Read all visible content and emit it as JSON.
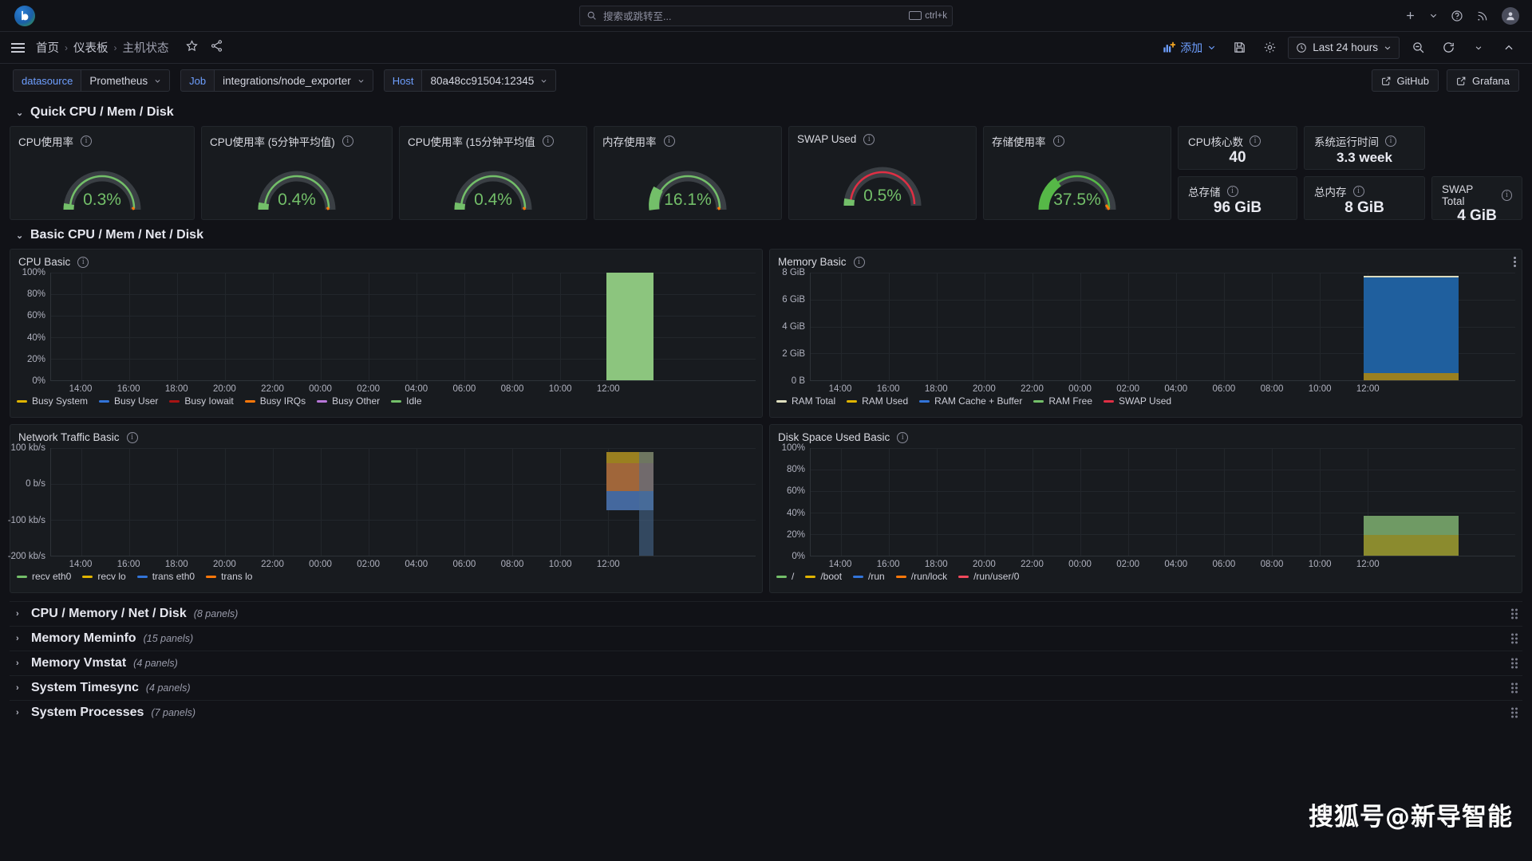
{
  "topbar": {
    "logo_letter": "b",
    "search_placeholder": "搜索或跳转至...",
    "shortcut": "ctrl+k",
    "icons": [
      "plus-icon",
      "chevron-down-icon",
      "help-icon",
      "news-icon",
      "avatar"
    ]
  },
  "navbar": {
    "breadcrumbs": [
      {
        "label": "首页"
      },
      {
        "label": "仪表板"
      },
      {
        "label": "主机状态"
      }
    ],
    "separator": "›",
    "star_icon": "star-icon",
    "share_icon": "share-icon",
    "add_label": "添加",
    "time_range": "Last 24 hours",
    "icons": [
      "save-icon",
      "settings-gear-icon",
      "zoom-out-icon",
      "refresh-icon",
      "collapse-icon"
    ]
  },
  "variables": [
    {
      "name": "datasource",
      "value": "Prometheus"
    },
    {
      "name": "Job",
      "value": "integrations/node_exporter"
    },
    {
      "name": "Host",
      "value": "80a48cc91504:12345"
    }
  ],
  "links": [
    {
      "label": "GitHub"
    },
    {
      "label": "Grafana"
    }
  ],
  "rows": {
    "quick": "Quick CPU / Mem / Disk",
    "basic": "Basic CPU / Mem / Net / Disk"
  },
  "gauges": [
    {
      "title": "CPU使用率",
      "value": "0.3%",
      "pct": 0.3,
      "color": "#73bf69"
    },
    {
      "title": "CPU使用率 (5分钟平均值)",
      "value": "0.4%",
      "pct": 0.4,
      "color": "#73bf69"
    },
    {
      "title": "CPU使用率 (15分钟平均值",
      "value": "0.4%",
      "pct": 0.4,
      "color": "#73bf69"
    },
    {
      "title": "内存使用率",
      "value": "16.1%",
      "pct": 16.1,
      "color": "#73bf69"
    },
    {
      "title": "SWAP Used",
      "value": "0.5%",
      "pct": 0.5,
      "color": "#73bf69"
    },
    {
      "title": "存储使用率",
      "value": "37.5%",
      "pct": 37.5,
      "color": "#56b847"
    }
  ],
  "stats": [
    {
      "title": "CPU核心数",
      "value": "40"
    },
    {
      "title": "系统运行时间",
      "value": "3.3 week"
    },
    {
      "title": "总存储",
      "value": "96 GiB"
    },
    {
      "title": "总内存",
      "value": "8 GiB"
    },
    {
      "title": "SWAP Total",
      "value": "4 GiB"
    }
  ],
  "panels": {
    "cpu_basic": {
      "title": "CPU Basic"
    },
    "memory_basic": {
      "title": "Memory Basic"
    },
    "network_basic": {
      "title": "Network Traffic Basic"
    },
    "disk_basic": {
      "title": "Disk Space Used Basic"
    }
  },
  "collapsed_rows": [
    {
      "title": "CPU / Memory / Net / Disk",
      "panels": "(8 panels)"
    },
    {
      "title": "Memory Meminfo",
      "panels": "(15 panels)"
    },
    {
      "title": "Memory Vmstat",
      "panels": "(4 panels)"
    },
    {
      "title": "System Timesync",
      "panels": "(4 panels)"
    },
    {
      "title": "System Processes",
      "panels": "(7 panels)"
    }
  ],
  "watermark": "搜狐号@新导智能",
  "chart_data": [
    {
      "type": "area",
      "title": "CPU Basic",
      "xlabel": "",
      "ylabel": "",
      "ylim": [
        0,
        100
      ],
      "yticks": [
        "0%",
        "20%",
        "40%",
        "60%",
        "80%",
        "100%"
      ],
      "xticks": [
        "14:00",
        "16:00",
        "18:00",
        "20:00",
        "22:00",
        "00:00",
        "02:00",
        "04:00",
        "06:00",
        "08:00",
        "10:00",
        "12:00"
      ],
      "legend": [
        {
          "name": "Busy System",
          "color": "#e0b400"
        },
        {
          "name": "Busy User",
          "color": "#3274d9"
        },
        {
          "name": "Busy Iowait",
          "color": "#a81414"
        },
        {
          "name": "Busy IRQs",
          "color": "#ff780a"
        },
        {
          "name": "Busy Other",
          "color": "#b877d9"
        },
        {
          "name": "Idle",
          "color": "#8ab8ff"
        }
      ],
      "series": [
        {
          "name": "Idle",
          "color": "#8cc57e",
          "values": [
            0,
            0,
            0,
            0,
            0,
            0,
            0,
            0,
            0,
            0,
            0,
            100
          ]
        }
      ],
      "note": "Only the right-most time bucket has data; a full-height green Idle band occupies the last ~6% of the x-axis."
    },
    {
      "type": "area",
      "title": "Memory Basic",
      "xlabel": "",
      "ylabel": "",
      "ylim": [
        0,
        8
      ],
      "yunit": "GiB",
      "yticks": [
        "0 B",
        "2 GiB",
        "4 GiB",
        "6 GiB",
        "8 GiB"
      ],
      "xticks": [
        "14:00",
        "16:00",
        "18:00",
        "20:00",
        "22:00",
        "00:00",
        "02:00",
        "04:00",
        "06:00",
        "08:00",
        "10:00",
        "12:00"
      ],
      "legend": [
        {
          "name": "RAM Total",
          "color": "#e0e0c0"
        },
        {
          "name": "RAM Used",
          "color": "#e0b400"
        },
        {
          "name": "RAM Cache + Buffer",
          "color": "#3274d9"
        },
        {
          "name": "RAM Free",
          "color": "#73bf69"
        },
        {
          "name": "SWAP Used",
          "color": "#e02f44"
        }
      ],
      "series": [
        {
          "name": "RAM Cache + Buffer",
          "color": "#1f5f9e",
          "values": [
            0,
            0,
            0,
            0,
            0,
            0,
            0,
            0,
            0,
            0,
            0,
            7.3
          ]
        },
        {
          "name": "RAM Used",
          "color": "#9a8020",
          "values": [
            0,
            0,
            0,
            0,
            0,
            0,
            0,
            0,
            0,
            0,
            0,
            0.6
          ]
        }
      ],
      "note": "Only the last time bucket has data; stacked band nearly fills to 8 GiB."
    },
    {
      "type": "area",
      "title": "Network Traffic Basic",
      "xlabel": "",
      "ylabel": "",
      "ylim": [
        -200,
        100
      ],
      "yunit": "b/s",
      "yticks": [
        "-200 kb/s",
        "-100 kb/s",
        "0 b/s",
        "100 kb/s"
      ],
      "xticks": [
        "14:00",
        "16:00",
        "18:00",
        "20:00",
        "22:00",
        "00:00",
        "02:00",
        "04:00",
        "06:00",
        "08:00",
        "10:00",
        "12:00"
      ],
      "legend": [
        {
          "name": "recv eth0",
          "color": "#73bf69"
        },
        {
          "name": "recv lo",
          "color": "#e0b400"
        },
        {
          "name": "trans eth0",
          "color": "#3274d9"
        },
        {
          "name": "trans lo",
          "color": "#ff780a"
        }
      ],
      "series": [
        {
          "name": "recv lo",
          "color": "#9a8020",
          "values": [
            0,
            0,
            0,
            0,
            0,
            0,
            0,
            0,
            0,
            0,
            0,
            90
          ]
        },
        {
          "name": "trans lo",
          "color": "#a0663a",
          "values": [
            0,
            0,
            0,
            0,
            0,
            0,
            0,
            0,
            0,
            0,
            0,
            -60
          ]
        },
        {
          "name": "trans eth0",
          "color": "#44689e",
          "values": [
            0,
            0,
            0,
            0,
            0,
            0,
            0,
            0,
            0,
            0,
            0,
            -120
          ]
        }
      ],
      "note": "Only the last time bucket has data; positive recv band and negative trans bands."
    },
    {
      "type": "area",
      "title": "Disk Space Used Basic",
      "xlabel": "",
      "ylabel": "",
      "ylim": [
        0,
        100
      ],
      "yticks": [
        "0%",
        "20%",
        "40%",
        "60%",
        "80%",
        "100%"
      ],
      "xticks": [
        "14:00",
        "16:00",
        "18:00",
        "20:00",
        "22:00",
        "00:00",
        "02:00",
        "04:00",
        "06:00",
        "08:00",
        "10:00",
        "12:00"
      ],
      "legend": [
        {
          "name": "/",
          "color": "#73bf69"
        },
        {
          "name": "/boot",
          "color": "#e0b400"
        },
        {
          "name": "/run",
          "color": "#3274d9"
        },
        {
          "name": "/run/lock",
          "color": "#ff780a"
        },
        {
          "name": "/run/user/0",
          "color": "#f2495c"
        }
      ],
      "series": [
        {
          "name": "/boot",
          "color": "#8b8b2e",
          "values": [
            0,
            0,
            0,
            0,
            0,
            0,
            0,
            0,
            0,
            0,
            0,
            20
          ]
        },
        {
          "name": "/",
          "color": "#6f9a64",
          "values": [
            0,
            0,
            0,
            0,
            0,
            0,
            0,
            0,
            0,
            0,
            0,
            17
          ]
        }
      ],
      "note": "Only the last time bucket has data; stacked bands reaching ~37%."
    }
  ]
}
